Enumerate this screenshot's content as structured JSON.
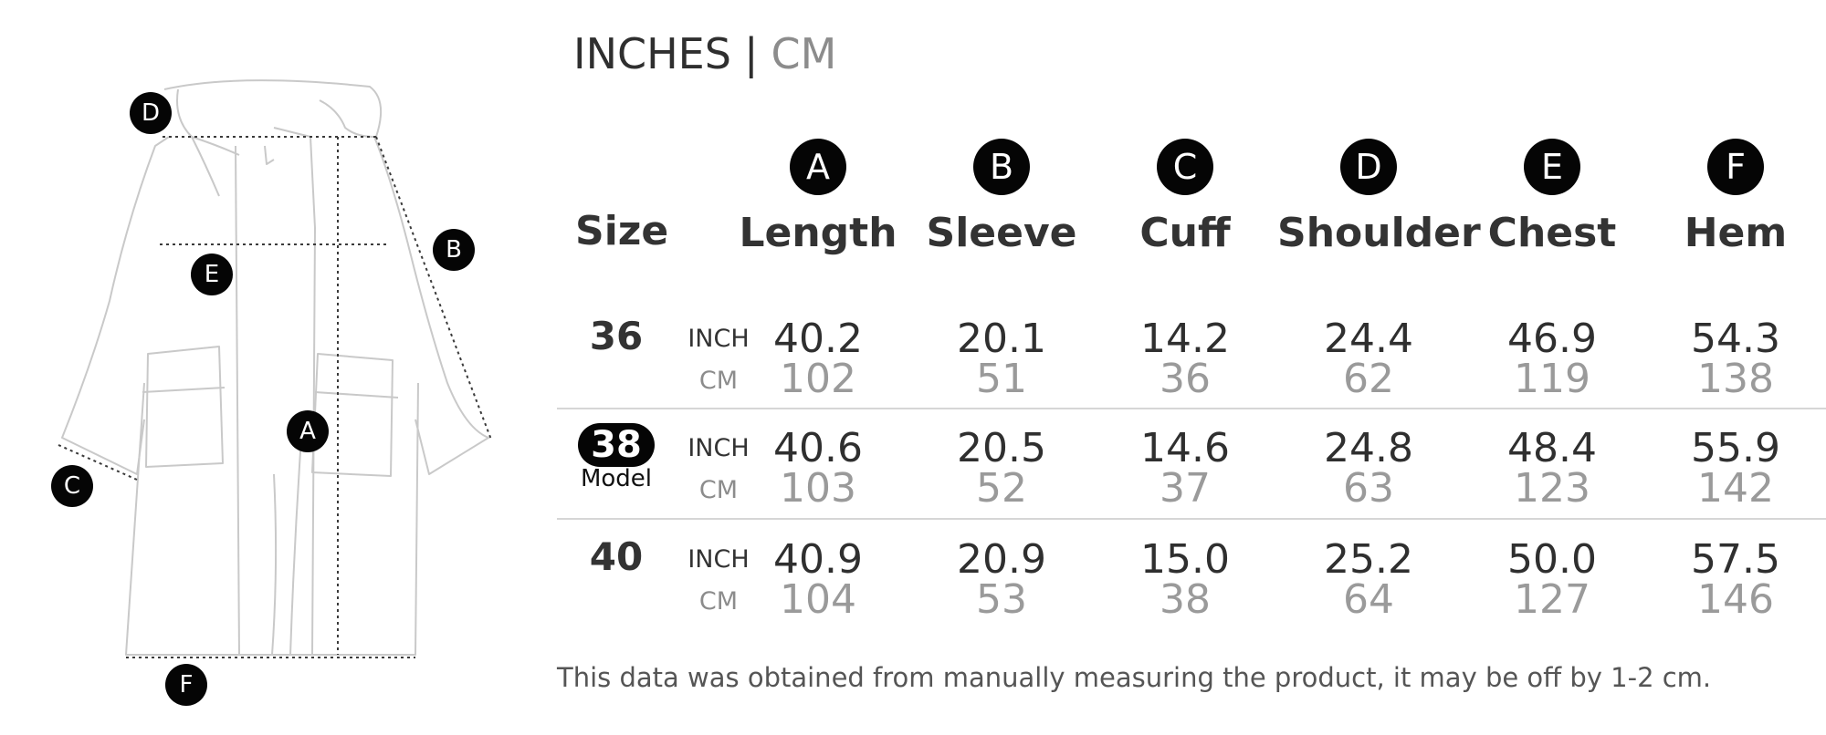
{
  "units": {
    "active": "INCHES",
    "separator": "|",
    "inactive": "CM"
  },
  "size_header": "Size",
  "diagram_markers": [
    "D",
    "B",
    "E",
    "A",
    "C",
    "F"
  ],
  "columns": [
    {
      "badge": "A",
      "label": "Length"
    },
    {
      "badge": "B",
      "label": "Sleeve"
    },
    {
      "badge": "C",
      "label": "Cuff"
    },
    {
      "badge": "D",
      "label": "Shoulder"
    },
    {
      "badge": "E",
      "label": "Chest"
    },
    {
      "badge": "F",
      "label": "Hem"
    }
  ],
  "unit_labels": {
    "inch": "INCH",
    "cm": "CM"
  },
  "rows": [
    {
      "size": "36",
      "note": "",
      "highlighted": false,
      "inch": [
        "40.2",
        "20.1",
        "14.2",
        "24.4",
        "46.9",
        "54.3"
      ],
      "cm": [
        "102",
        "51",
        "36",
        "62",
        "119",
        "138"
      ]
    },
    {
      "size": "38",
      "note": "Model",
      "highlighted": true,
      "inch": [
        "40.6",
        "20.5",
        "14.6",
        "24.8",
        "48.4",
        "55.9"
      ],
      "cm": [
        "103",
        "52",
        "37",
        "63",
        "123",
        "142"
      ]
    },
    {
      "size": "40",
      "note": "",
      "highlighted": false,
      "inch": [
        "40.9",
        "20.9",
        "15.0",
        "25.2",
        "50.0",
        "57.5"
      ],
      "cm": [
        "104",
        "53",
        "38",
        "64",
        "127",
        "146"
      ]
    }
  ],
  "footnote": "This data was obtained from manually measuring the product, it may be off by 1-2 cm.",
  "colors": {
    "badge": "#050505",
    "primary_text": "#2f2f2f",
    "secondary_text": "#9a9a9a",
    "divider": "#d6d6d6"
  }
}
